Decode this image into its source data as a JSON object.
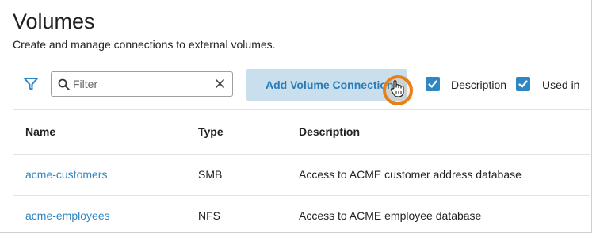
{
  "page": {
    "title": "Volumes",
    "subtitle": "Create and manage connections to external volumes."
  },
  "toolbar": {
    "filter_placeholder": "Filter",
    "add_button_label": "Add Volume Connection",
    "column_toggles": [
      {
        "label": "Description",
        "checked": true
      },
      {
        "label": "Used in",
        "checked": true
      }
    ]
  },
  "table": {
    "columns": [
      "Name",
      "Type",
      "Description"
    ],
    "rows": [
      {
        "name": "acme-customers",
        "type": "SMB",
        "description": "Access to ACME customer address database"
      },
      {
        "name": "acme-employees",
        "type": "NFS",
        "description": "Access to ACME employee database"
      }
    ]
  },
  "colors": {
    "accent": "#2f86c5",
    "button_bg": "#c9dfee",
    "cursor_highlight": "#e8801a"
  }
}
